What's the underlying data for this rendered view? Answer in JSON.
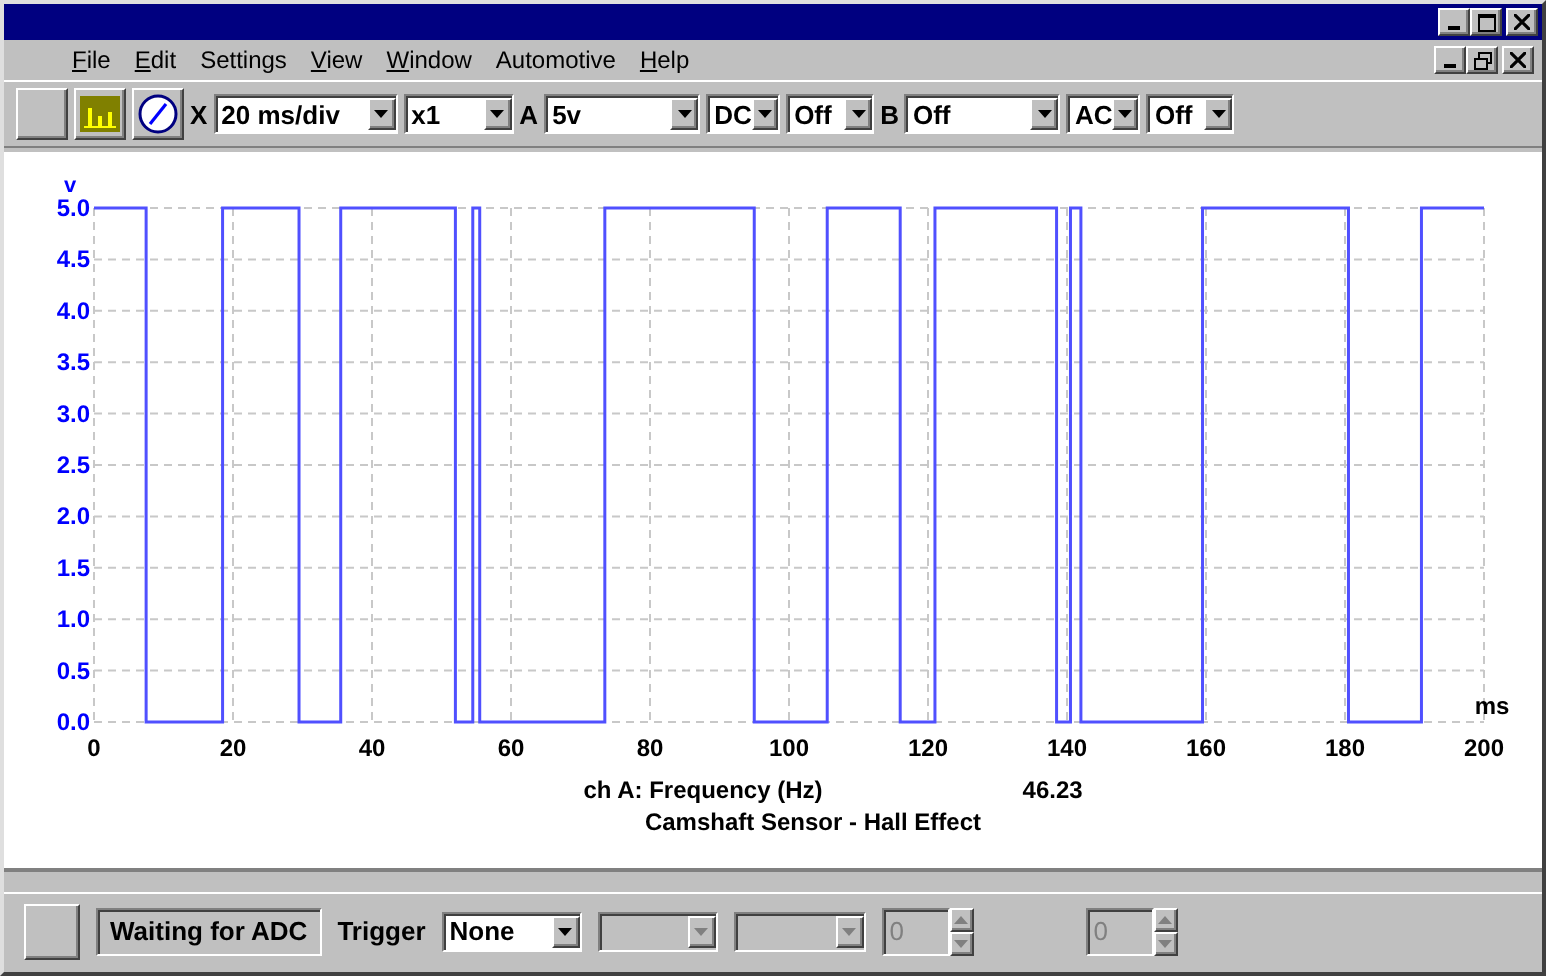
{
  "menu": [
    {
      "label": "File",
      "underlined_first": true
    },
    {
      "label": "Edit",
      "underlined_first": true
    },
    {
      "label": "Settings",
      "underlined_first": false
    },
    {
      "label": "View",
      "underlined_first": true
    },
    {
      "label": "Window",
      "underlined_first": true
    },
    {
      "label": "Automotive",
      "underlined_first": false
    },
    {
      "label": "Help",
      "underlined_first": true
    }
  ],
  "toolbar": [
    {
      "kind": "blank-button"
    },
    {
      "kind": "chart-button"
    },
    {
      "kind": "gauge-button"
    },
    {
      "kind": "label",
      "text": "X"
    },
    {
      "kind": "dropdown",
      "value": "20 ms/div"
    },
    {
      "kind": "dropdown",
      "value": "x1"
    },
    {
      "kind": "label",
      "text": "A"
    },
    {
      "kind": "dropdown",
      "value": "5v"
    },
    {
      "kind": "dropdown",
      "value": "DC"
    },
    {
      "kind": "dropdown",
      "value": "Off"
    },
    {
      "kind": "label",
      "text": "B"
    },
    {
      "kind": "dropdown",
      "value": "Off"
    },
    {
      "kind": "dropdown",
      "value": "AC"
    },
    {
      "kind": "dropdown",
      "value": "Off"
    }
  ],
  "chart_data": {
    "type": "line",
    "grid": true,
    "ylabel": "v",
    "xlabel": "ms",
    "xlim": [
      0,
      200
    ],
    "ylim": [
      0,
      5
    ],
    "xticks": [
      0,
      20,
      40,
      60,
      80,
      100,
      120,
      140,
      160,
      180,
      200
    ],
    "yticks": [
      {
        "value": 0,
        "label": "0.0"
      },
      {
        "value": 0.5,
        "label": "0.5"
      },
      {
        "value": 1,
        "label": "1.0"
      },
      {
        "value": 1.5,
        "label": "1.5"
      },
      {
        "value": 2,
        "label": "2.0"
      },
      {
        "value": 2.5,
        "label": "2.5"
      },
      {
        "value": 3,
        "label": "3.0"
      },
      {
        "value": 3.5,
        "label": "3.5"
      },
      {
        "value": 4,
        "label": "4.0"
      },
      {
        "value": 4.5,
        "label": "4.5"
      },
      {
        "value": 5,
        "label": "5.0"
      }
    ],
    "x": [
      0,
      7.5,
      7.5,
      18.5,
      18.5,
      29.5,
      29.5,
      35.5,
      35.5,
      52,
      52,
      54.5,
      54.5,
      55.5,
      55.5,
      73.5,
      73.5,
      95,
      95,
      105.5,
      105.5,
      116,
      116,
      121,
      121,
      138.5,
      138.5,
      140.5,
      140.5,
      142,
      142,
      159.5,
      159.5,
      180.5,
      180.5,
      191,
      191,
      200
    ],
    "series": [
      {
        "color": "#5050ff",
        "values": [
          5,
          5,
          0,
          0,
          5,
          5,
          0,
          0,
          5,
          5,
          0,
          0,
          5,
          5,
          0,
          0,
          5,
          5,
          0,
          0,
          5,
          5,
          0,
          0,
          5,
          5,
          0,
          0,
          5,
          5,
          0,
          0,
          5,
          5,
          0,
          0,
          5,
          5
        ]
      }
    ]
  },
  "measurement": {
    "label": "ch A: Frequency (Hz)",
    "value": "46.23"
  },
  "caption": "Camshaft Sensor - Hall Effect",
  "status_bar": [
    {
      "kind": "blank-button"
    },
    {
      "kind": "panel",
      "text": "Waiting for ADC"
    },
    {
      "kind": "label",
      "text": "Trigger"
    },
    {
      "kind": "dropdown",
      "value": "None",
      "disabled": false
    },
    {
      "kind": "dropdown",
      "disabled": true
    },
    {
      "kind": "dropdown",
      "disabled": true
    },
    {
      "kind": "spinner",
      "value": "0",
      "disabled": true
    },
    {
      "kind": "spinner",
      "value": "0",
      "disabled": true
    }
  ]
}
